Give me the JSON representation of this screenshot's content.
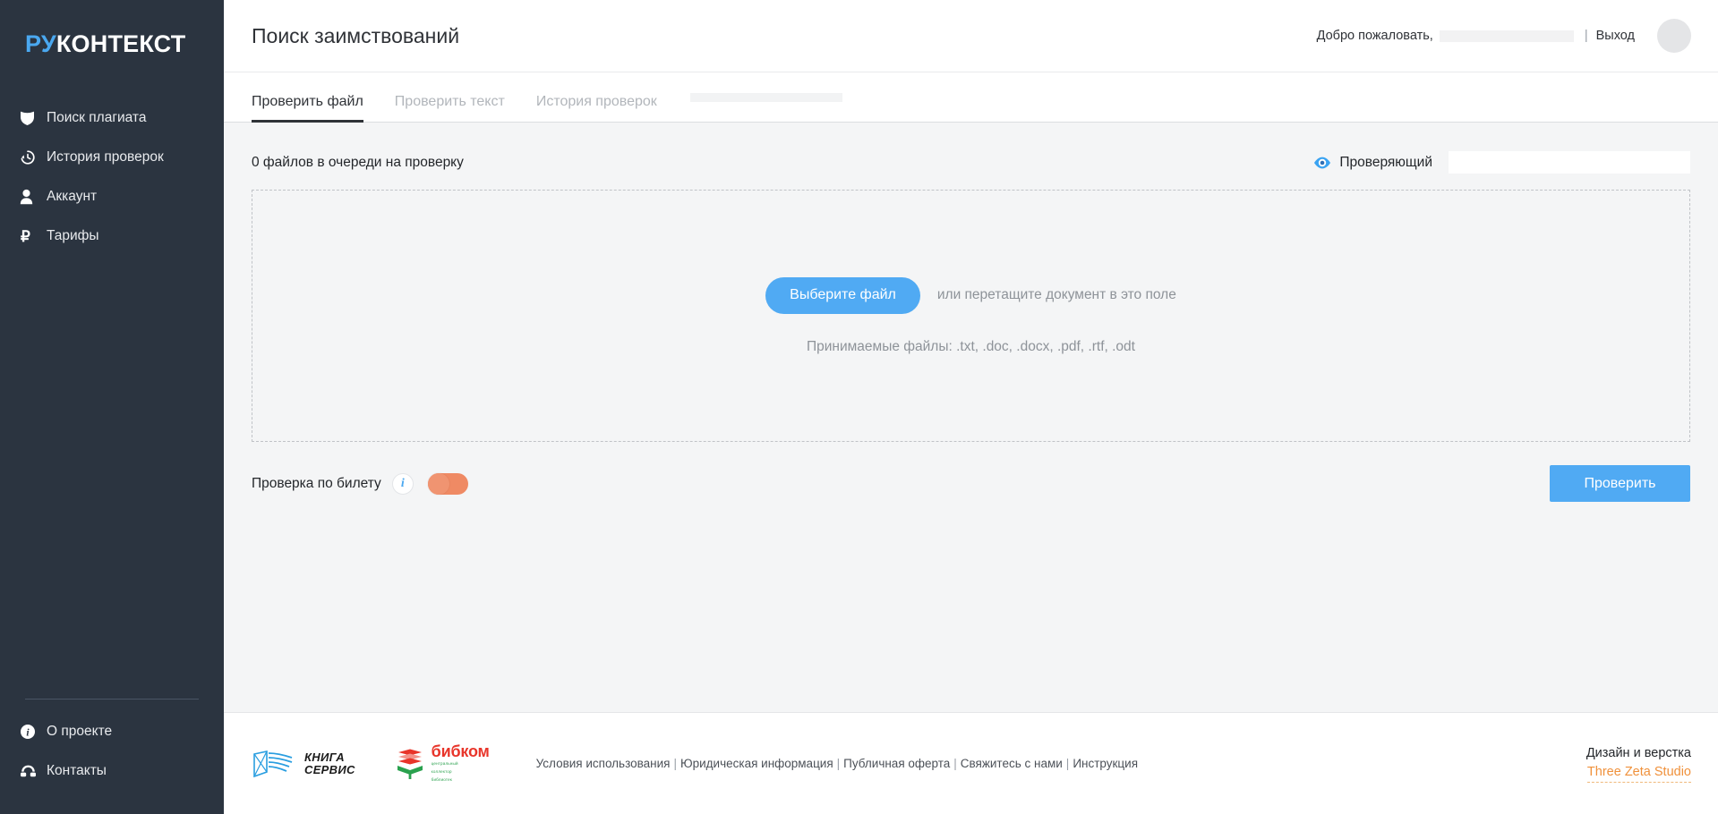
{
  "sidebar": {
    "logo": {
      "part1": "РУ",
      "part2": "КОНТЕКСТ"
    },
    "items": [
      {
        "label": "Поиск плагиата",
        "icon": "shield-icon"
      },
      {
        "label": "История проверок",
        "icon": "history-clock-icon"
      },
      {
        "label": "Аккаунт",
        "icon": "user-icon"
      },
      {
        "label": "Тарифы",
        "icon": "ruble-icon"
      }
    ],
    "bottom_items": [
      {
        "label": "О проекте",
        "icon": "info-circle-icon"
      },
      {
        "label": "Контакты",
        "icon": "phone-icon"
      }
    ]
  },
  "header": {
    "title": "Поиск заимствований",
    "welcome": "Добро пожаловать,",
    "separator": "|",
    "logout": "Выход"
  },
  "tabs": [
    {
      "label": "Проверить файл",
      "active": true
    },
    {
      "label": "Проверить текст",
      "active": false
    },
    {
      "label": "История проверок",
      "active": false
    }
  ],
  "main": {
    "queue_text": "0 файлов в очереди на проверку",
    "reviewer_label": "Проверяющий",
    "reviewer_value": "",
    "reviewer_placeholder": "",
    "choose_file_button": "Выберите файл",
    "drop_hint": "или перетащите документ в это поле",
    "accepted_formats": "Принимаемые файлы: .txt, .doc, .docx, .pdf, .rtf, .odt",
    "ticket_label": "Проверка по билету",
    "ticket_info_glyph": "i",
    "ticket_toggle_state": "off",
    "check_button": "Проверить"
  },
  "footer": {
    "logo_knigaservis": {
      "line1": "КНИГА",
      "line2": "СЕРВИС"
    },
    "logo_bibkom": {
      "main": "бибком",
      "sub1": "центральный",
      "sub2": "коллектор",
      "sub3": "библиотек"
    },
    "links": [
      "Условия использования",
      "Юридическая информация",
      "Публичная оферта",
      "Свяжитесь с нами",
      "Инструкция"
    ],
    "credits_line1": "Дизайн и верстка",
    "credits_line2": "Three Zeta Studio"
  },
  "colors": {
    "sidebar_bg": "#2b3440",
    "accent_blue": "#50aaf3",
    "logo_blue": "#4aa8f0",
    "toggle_orange": "#ef8a64",
    "credits_orange": "#f0913b",
    "page_bg": "#f4f5f6"
  }
}
